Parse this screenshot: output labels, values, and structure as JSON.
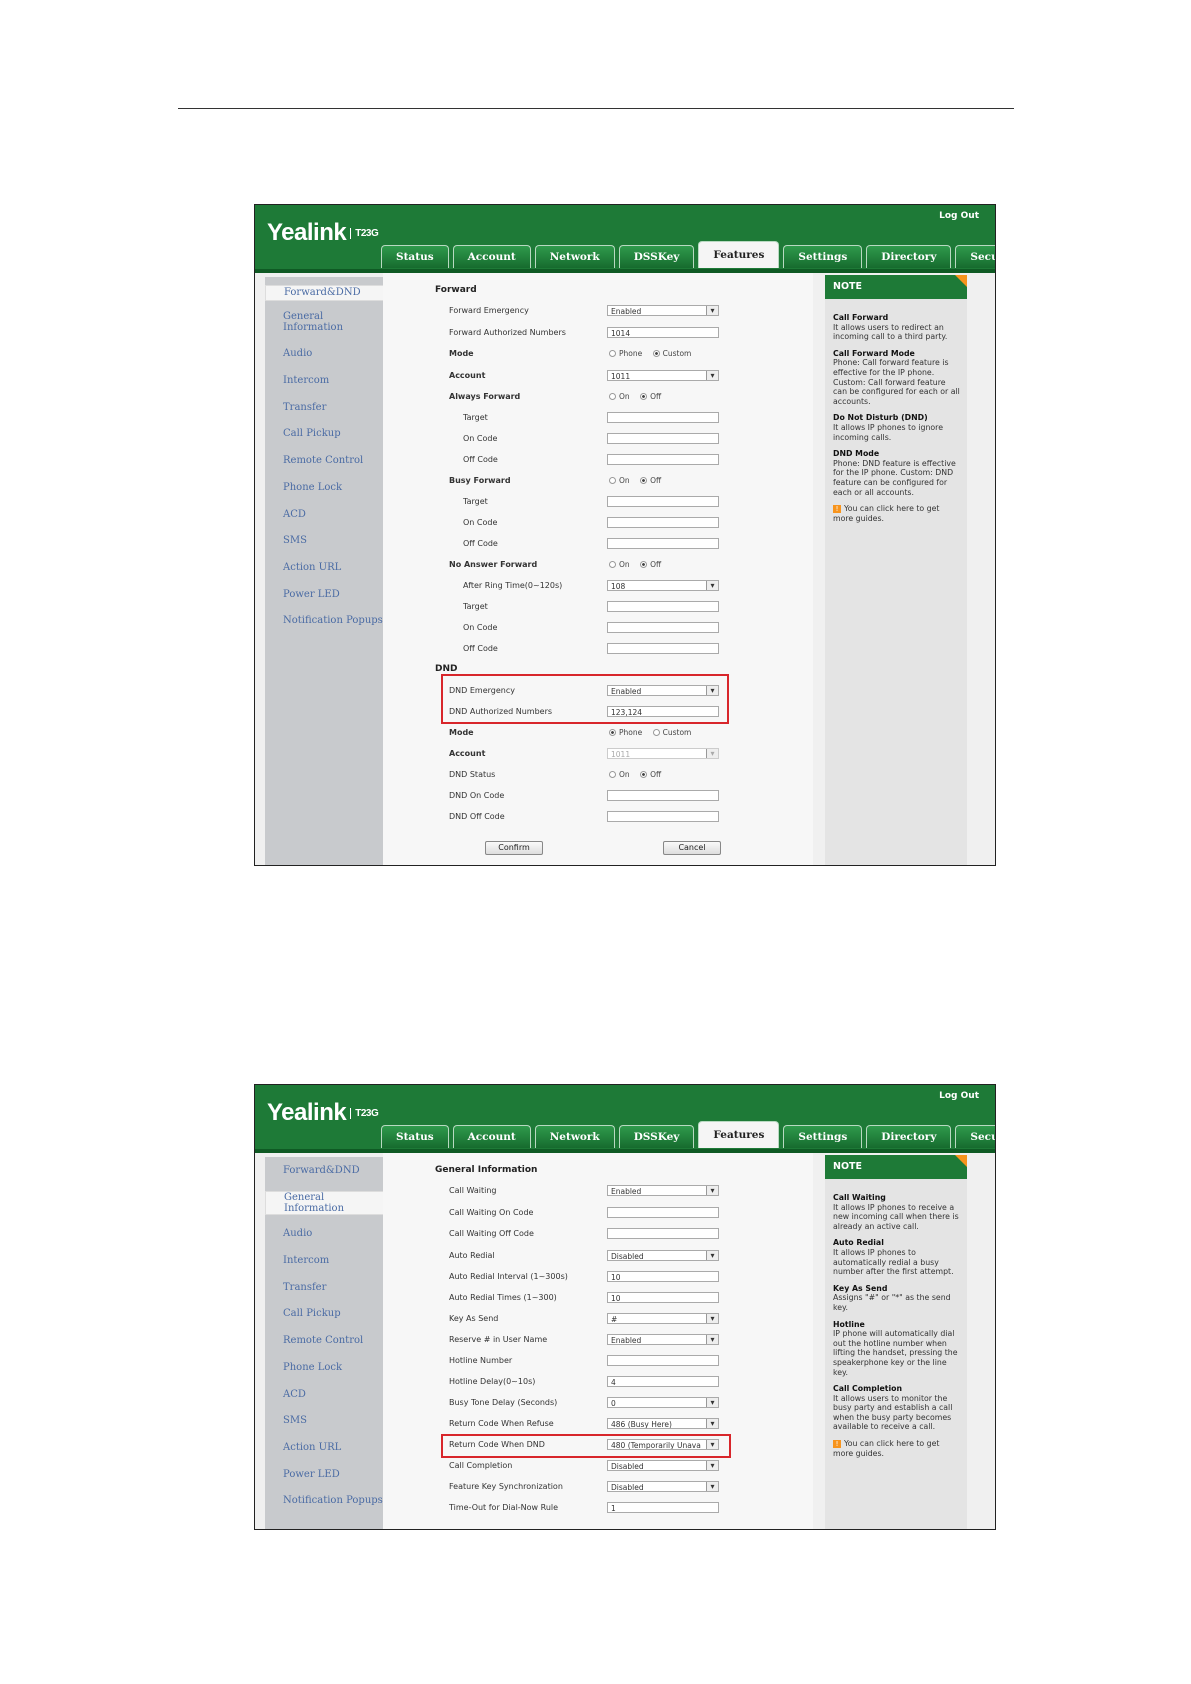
{
  "screenshot1": {
    "logo": "Yealink",
    "model": "T23G",
    "logout": "Log Out",
    "tabs": [
      "Status",
      "Account",
      "Network",
      "DSSKey",
      "Features",
      "Settings",
      "Directory",
      "Security"
    ],
    "active_tab": "Features",
    "sidebar": [
      "Forward&DND",
      "General Information",
      "Audio",
      "Intercom",
      "Transfer",
      "Call Pickup",
      "Remote Control",
      "Phone Lock",
      "ACD",
      "SMS",
      "Action URL",
      "Power LED",
      "Notification Popups"
    ],
    "active_sidebar": "Forward&DND",
    "forward_title": "Forward",
    "dnd_title": "DND",
    "rows": {
      "fwd_emergency": {
        "label": "Forward Emergency",
        "value": "Enabled"
      },
      "fwd_auth": {
        "label": "Forward Authorized Numbers",
        "value": "1014"
      },
      "mode": {
        "label": "Mode",
        "opt1": "Phone",
        "opt2": "Custom",
        "selected": "Custom"
      },
      "account": {
        "label": "Account",
        "value": "1011"
      },
      "always": {
        "label": "Always Forward",
        "opt1": "On",
        "opt2": "Off",
        "selected": "Off"
      },
      "target": "Target",
      "on_code": "On Code",
      "off_code": "Off Code",
      "busy": {
        "label": "Busy Forward",
        "opt1": "On",
        "opt2": "Off",
        "selected": "Off"
      },
      "noanswer": {
        "label": "No Answer Forward",
        "opt1": "On",
        "opt2": "Off",
        "selected": "Off"
      },
      "ring_time": {
        "label": "After Ring Time(0~120s)",
        "value": "108"
      },
      "dnd_emergency": {
        "label": "DND Emergency",
        "value": "Enabled"
      },
      "dnd_auth": {
        "label": "DND Authorized Numbers",
        "value": "123,124"
      },
      "dnd_mode": {
        "label": "Mode",
        "opt1": "Phone",
        "opt2": "Custom",
        "selected": "Phone"
      },
      "dnd_account": {
        "label": "Account",
        "value": "1011"
      },
      "dnd_status": {
        "label": "DND Status",
        "opt1": "On",
        "opt2": "Off",
        "selected": "Off"
      },
      "dnd_on_code": {
        "label": "DND On Code"
      },
      "dnd_off_code": {
        "label": "DND Off Code"
      }
    },
    "confirm": "Confirm",
    "cancel": "Cancel",
    "note": {
      "title": "NOTE",
      "items": [
        {
          "head": "Call Forward",
          "body": "It allows users to redirect an incoming call to a third party."
        },
        {
          "head": "Call Forward Mode",
          "body": "Phone: Call forward feature is effective for the IP phone. Custom: Call forward feature can be configured for each or all accounts."
        },
        {
          "head": "Do Not Disturb (DND)",
          "body": "It allows IP phones to ignore incoming calls."
        },
        {
          "head": "DND Mode",
          "body": "Phone: DND feature is effective for the IP phone. Custom: DND feature can be configured for each or all accounts."
        }
      ],
      "guide": "You can click here to get more guides."
    }
  },
  "screenshot2": {
    "logo": "Yealink",
    "model": "T23G",
    "logout": "Log Out",
    "tabs": [
      "Status",
      "Account",
      "Network",
      "DSSKey",
      "Features",
      "Settings",
      "Directory",
      "Security"
    ],
    "sidebar": [
      "Forward&DND",
      "General Information",
      "Audio",
      "Intercom",
      "Transfer",
      "Call Pickup",
      "Remote Control",
      "Phone Lock",
      "ACD",
      "SMS",
      "Action URL",
      "Power LED",
      "Notification Popups"
    ],
    "section_title": "General Information",
    "rows": [
      {
        "label": "Call Waiting",
        "value": "Enabled",
        "type": "select"
      },
      {
        "label": "Call Waiting On Code",
        "value": "",
        "type": "input"
      },
      {
        "label": "Call Waiting Off Code",
        "value": "",
        "type": "input"
      },
      {
        "label": "Auto Redial",
        "value": "Disabled",
        "type": "select"
      },
      {
        "label": "Auto Redial Interval (1~300s)",
        "value": "10",
        "type": "input"
      },
      {
        "label": "Auto Redial Times (1~300)",
        "value": "10",
        "type": "input"
      },
      {
        "label": "Key As Send",
        "value": "#",
        "type": "select"
      },
      {
        "label": "Reserve # in User Name",
        "value": "Enabled",
        "type": "select"
      },
      {
        "label": "Hotline Number",
        "value": "",
        "type": "input"
      },
      {
        "label": "Hotline Delay(0~10s)",
        "value": "4",
        "type": "input"
      },
      {
        "label": "Busy Tone Delay (Seconds)",
        "value": "0",
        "type": "select"
      },
      {
        "label": "Return Code When Refuse",
        "value": "486 (Busy Here)",
        "type": "select"
      },
      {
        "label": "Return Code When DND",
        "value": "480 (Temporarily Unava",
        "type": "select"
      },
      {
        "label": "Call Completion",
        "value": "Disabled",
        "type": "select"
      },
      {
        "label": "Feature Key Synchronization",
        "value": "Disabled",
        "type": "select"
      },
      {
        "label": "Time-Out for Dial-Now Rule",
        "value": "1",
        "type": "input"
      }
    ],
    "note": {
      "title": "NOTE",
      "items": [
        {
          "head": "Call Waiting",
          "body": "It allows IP phones to receive a new incoming call when there is already an active call."
        },
        {
          "head": "Auto Redial",
          "body": "It allows IP phones to automatically redial a busy number after the first attempt."
        },
        {
          "head": "Key As Send",
          "body": "Assigns \"#\" or \"*\" as the send key."
        },
        {
          "head": "Hotline",
          "body": "IP phone will automatically dial out the hotline number when lifting the handset, pressing the speakerphone key or the line key."
        },
        {
          "head": "Call Completion",
          "body": "It allows users to monitor the busy party and establish a call when the busy party becomes available to receive a call."
        }
      ],
      "guide": "You can click here to get more guides."
    }
  }
}
